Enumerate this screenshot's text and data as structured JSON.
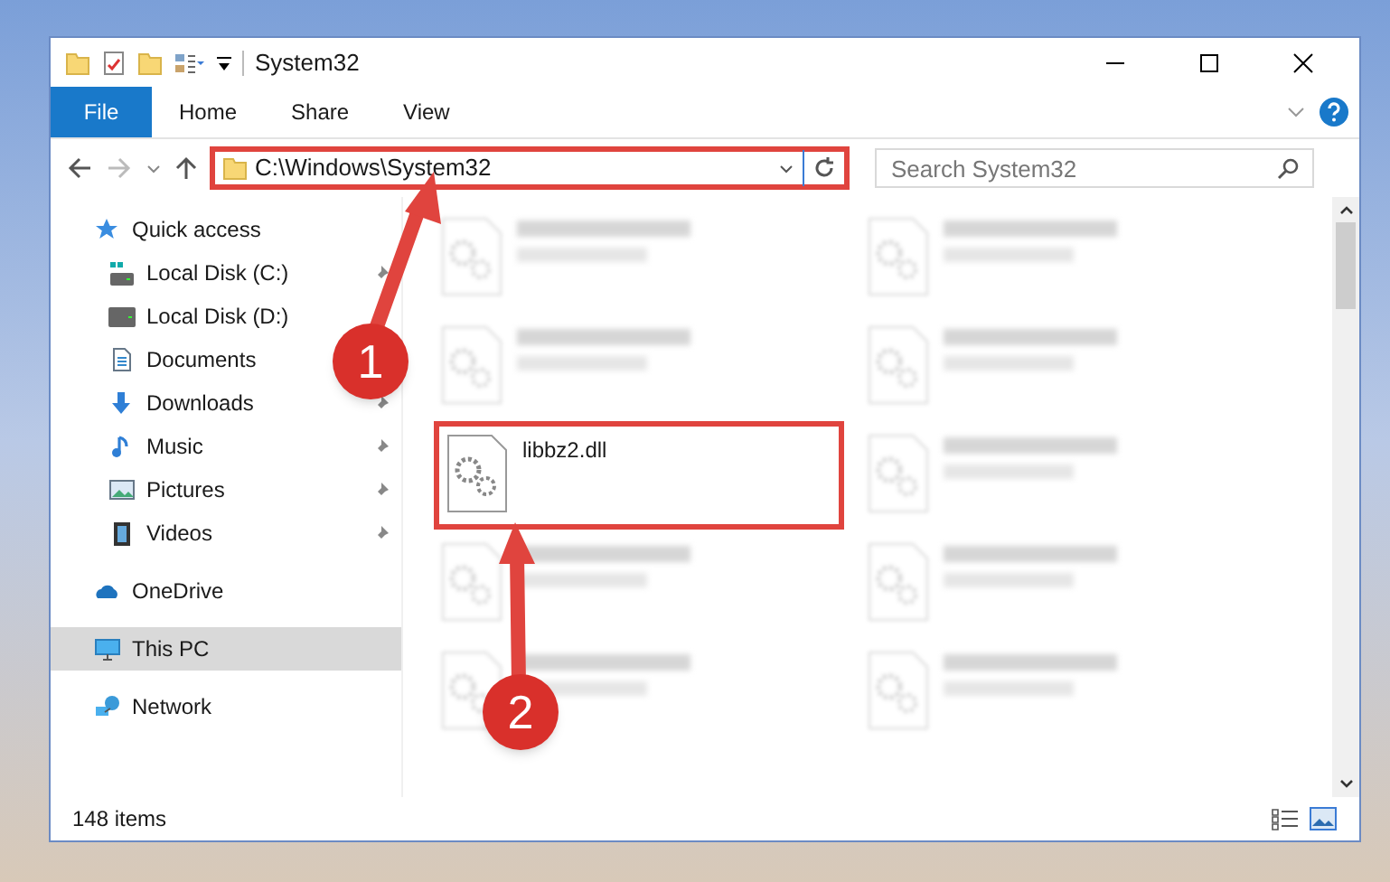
{
  "window": {
    "title": "System32"
  },
  "ribbon": {
    "tabs": [
      {
        "label": "File",
        "selected": true
      },
      {
        "label": "Home",
        "selected": false
      },
      {
        "label": "Share",
        "selected": false
      },
      {
        "label": "View",
        "selected": false
      }
    ]
  },
  "address_bar": {
    "path": "C:\\Windows\\System32",
    "highlighted": true
  },
  "search": {
    "placeholder": "Search System32"
  },
  "sidebar": {
    "items": [
      {
        "label": "Quick access",
        "kind": "quick",
        "selected": false,
        "pinned": false,
        "children": [
          {
            "label": "Local Disk (C:)",
            "kind": "diskc",
            "selected": false,
            "pinned": true
          },
          {
            "label": "Local Disk (D:)",
            "kind": "disk",
            "selected": false,
            "pinned": false
          },
          {
            "label": "Documents",
            "kind": "docs",
            "selected": false,
            "pinned": false
          },
          {
            "label": "Downloads",
            "kind": "downloads",
            "selected": false,
            "pinned": true
          },
          {
            "label": "Music",
            "kind": "music",
            "selected": false,
            "pinned": true
          },
          {
            "label": "Pictures",
            "kind": "pictures",
            "selected": false,
            "pinned": true
          },
          {
            "label": "Videos",
            "kind": "videos",
            "selected": false,
            "pinned": true
          }
        ]
      },
      {
        "label": "OneDrive",
        "kind": "cloud",
        "selected": false,
        "pinned": false
      },
      {
        "label": "This PC",
        "kind": "pc",
        "selected": true,
        "pinned": false
      },
      {
        "label": "Network",
        "kind": "network",
        "selected": false,
        "pinned": false
      }
    ]
  },
  "files": [
    {
      "kind": "blurred"
    },
    {
      "kind": "blurred"
    },
    {
      "kind": "blurred"
    },
    {
      "kind": "blurred"
    },
    {
      "kind": "file",
      "name": "libbz2.dll",
      "highlighted": true
    },
    {
      "kind": "blurred"
    },
    {
      "kind": "blurred"
    },
    {
      "kind": "blurred"
    },
    {
      "kind": "blurred"
    },
    {
      "kind": "blurred"
    }
  ],
  "status_bar": {
    "count": "148 items"
  },
  "callouts": [
    {
      "number": "1"
    },
    {
      "number": "2"
    }
  ]
}
